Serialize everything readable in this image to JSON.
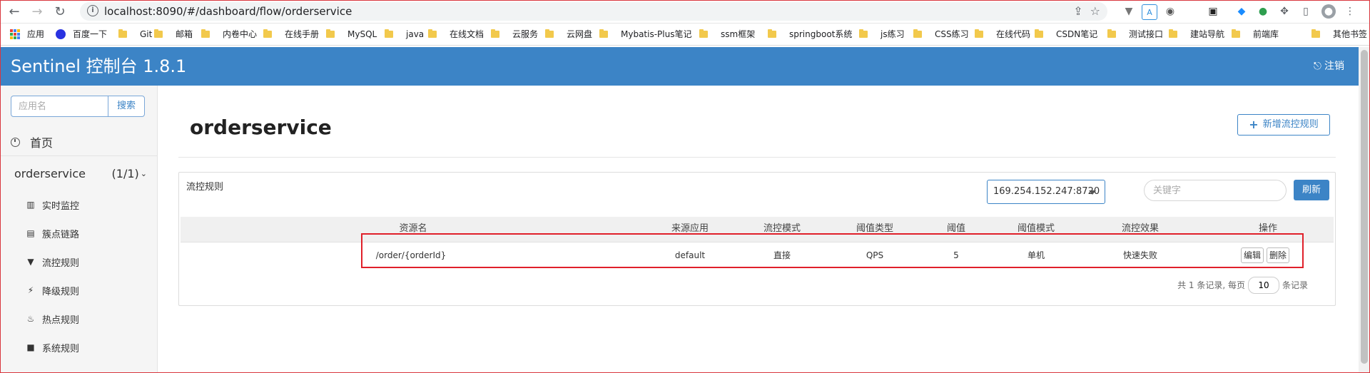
{
  "browser": {
    "url": "localhost:8090/#/dashboard/flow/orderservice",
    "bookmarks": [
      {
        "label": "应用",
        "icon": "apps-grid-icon"
      },
      {
        "label": "百度一下",
        "icon": "baidu-paw-icon"
      },
      {
        "label": "Git",
        "icon": "folder-icon"
      },
      {
        "label": "邮箱",
        "icon": "folder-icon"
      },
      {
        "label": "内卷中心",
        "icon": "folder-icon"
      },
      {
        "label": "在线手册",
        "icon": "folder-icon"
      },
      {
        "label": "MySQL",
        "icon": "folder-icon"
      },
      {
        "label": "java",
        "icon": "folder-icon"
      },
      {
        "label": "在线文档",
        "icon": "folder-icon"
      },
      {
        "label": "云服务",
        "icon": "folder-icon"
      },
      {
        "label": "云网盘",
        "icon": "folder-icon"
      },
      {
        "label": "Mybatis-Plus笔记",
        "icon": "folder-icon"
      },
      {
        "label": "ssm框架",
        "icon": "folder-icon"
      },
      {
        "label": "springboot系统",
        "icon": "folder-icon"
      },
      {
        "label": "js练习",
        "icon": "folder-icon"
      },
      {
        "label": "CSS练习",
        "icon": "folder-icon"
      },
      {
        "label": "在线代码",
        "icon": "folder-icon"
      },
      {
        "label": "CSDN笔记",
        "icon": "folder-icon"
      },
      {
        "label": "测试接口",
        "icon": "folder-icon"
      },
      {
        "label": "建站导航",
        "icon": "folder-icon"
      },
      {
        "label": "前端库",
        "icon": "folder-icon"
      }
    ],
    "other_bookmarks": "其他书签"
  },
  "app": {
    "title": "Sentinel 控制台 1.8.1",
    "logout": "注销",
    "accent_color": "#3c84c6"
  },
  "sidebar": {
    "search_placeholder": "应用名",
    "search_button": "搜索",
    "home": "首页",
    "app_name": "orderservice",
    "app_count": "(1/1)",
    "items": [
      {
        "label": "实时监控",
        "icon": "bar-chart-icon"
      },
      {
        "label": "簇点链路",
        "icon": "list-icon"
      },
      {
        "label": "流控规则",
        "icon": "filter-icon"
      },
      {
        "label": "降级规则",
        "icon": "flash-icon"
      },
      {
        "label": "热点规则",
        "icon": "fire-icon"
      },
      {
        "label": "系统规则",
        "icon": "lock-icon"
      }
    ]
  },
  "main": {
    "page_title": "orderservice",
    "add_button": "新增流控规则",
    "panel_title": "流控规则",
    "machine_selected": "169.254.152.247:8720",
    "keyword_placeholder": "关键字",
    "refresh_button": "刷新",
    "table": {
      "headers": [
        "资源名",
        "来源应用",
        "流控模式",
        "阈值类型",
        "阈值",
        "阈值模式",
        "流控效果",
        "操作"
      ],
      "rows": [
        {
          "resource": "/order/{orderId}",
          "origin": "default",
          "mode": "直接",
          "grade": "QPS",
          "count": "5",
          "cluster_mode": "单机",
          "effect": "快速失败",
          "edit": "编辑",
          "delete": "删除"
        }
      ]
    },
    "pager": {
      "total_text": "共 1 条记录, 每页",
      "page_size": "10",
      "suffix": "条记录"
    }
  }
}
